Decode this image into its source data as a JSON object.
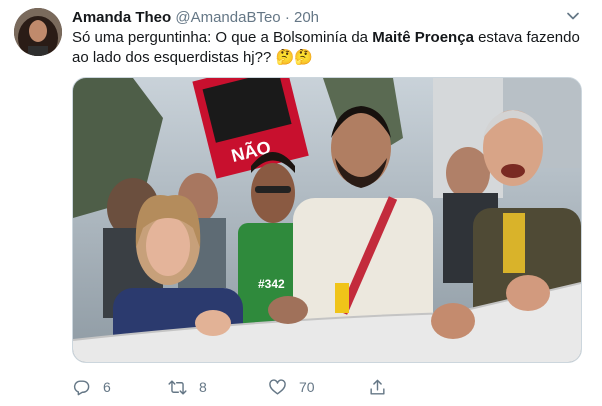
{
  "tweet": {
    "display_name": "Amanda Theo",
    "handle": "@AmandaBTeo",
    "separator": "·",
    "time": "20h",
    "text_part1": "Só uma perguntinha: O que a Bolsominía da ",
    "text_bold": "Maitê Proença",
    "text_part2": " estava fazendo ao lado dos esquerdistas hj?? ",
    "text_emojis": "🤔🤔",
    "media_sign_text": "NÃO",
    "media_shirt_text": "#342"
  },
  "actions": {
    "reply_count": "6",
    "retweet_count": "8",
    "like_count": "70"
  },
  "icons": [
    "chevron-down-icon",
    "reply-icon",
    "retweet-icon",
    "like-icon",
    "share-icon"
  ],
  "colors": {
    "muted": "#657786",
    "text": "#14171a",
    "thinking_face": "#f7c336"
  }
}
